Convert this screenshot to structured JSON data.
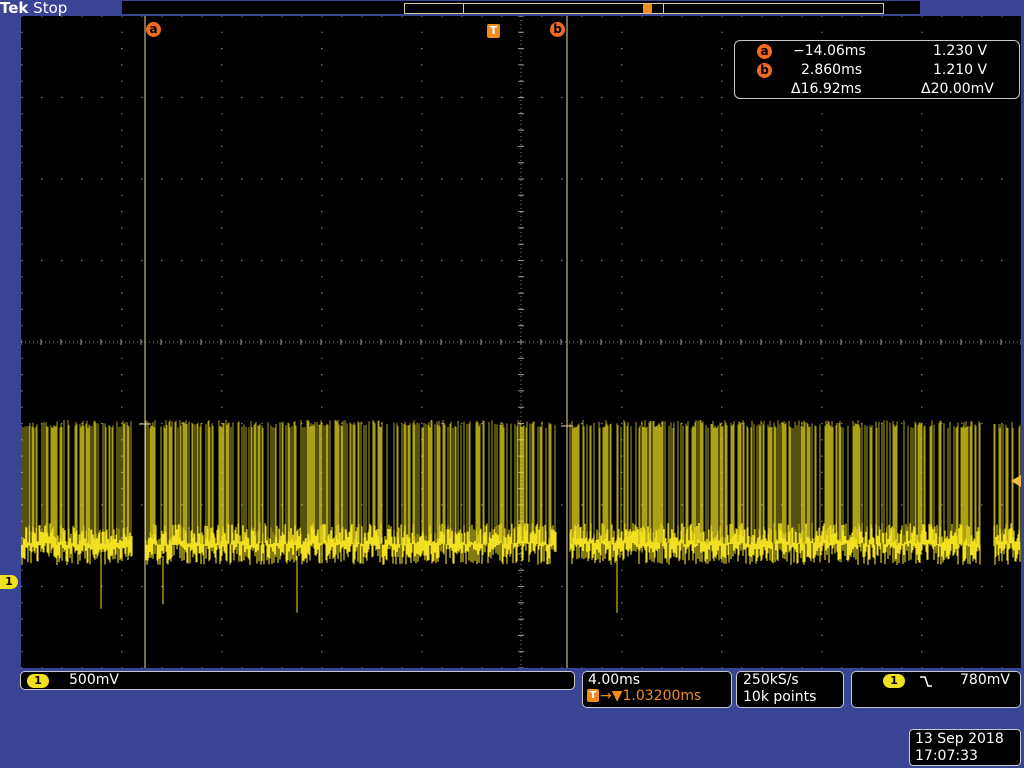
{
  "header": {
    "brand": "Tek",
    "status": "Stop"
  },
  "cursors": {
    "a_label": "a",
    "b_label": "b",
    "trigger_label": "T"
  },
  "readout": {
    "a_time": "−14.06ms",
    "a_volt": "1.230 V",
    "b_time": "2.860ms",
    "b_volt": "1.210 V",
    "delta_time": "Δ16.92ms",
    "delta_volt": "Δ20.00mV"
  },
  "channel": {
    "number": "1",
    "scale": "500mV",
    "color": "#f0e020"
  },
  "timebase": {
    "scale": "4.00ms",
    "trigger_position": "→▼1.03200ms"
  },
  "acquisition": {
    "sample_rate": "250kS/s",
    "record_length": "10k points"
  },
  "trigger": {
    "channel": "1",
    "slope_icon": "falling-edge-icon",
    "level": "780mV"
  },
  "datetime": {
    "date": "13 Sep  2018",
    "time": "17:07:33"
  },
  "colors": {
    "background": "#3a4494",
    "trace": "#f0e020",
    "cursor": "#f06a20",
    "trigger": "#f28a20"
  }
}
